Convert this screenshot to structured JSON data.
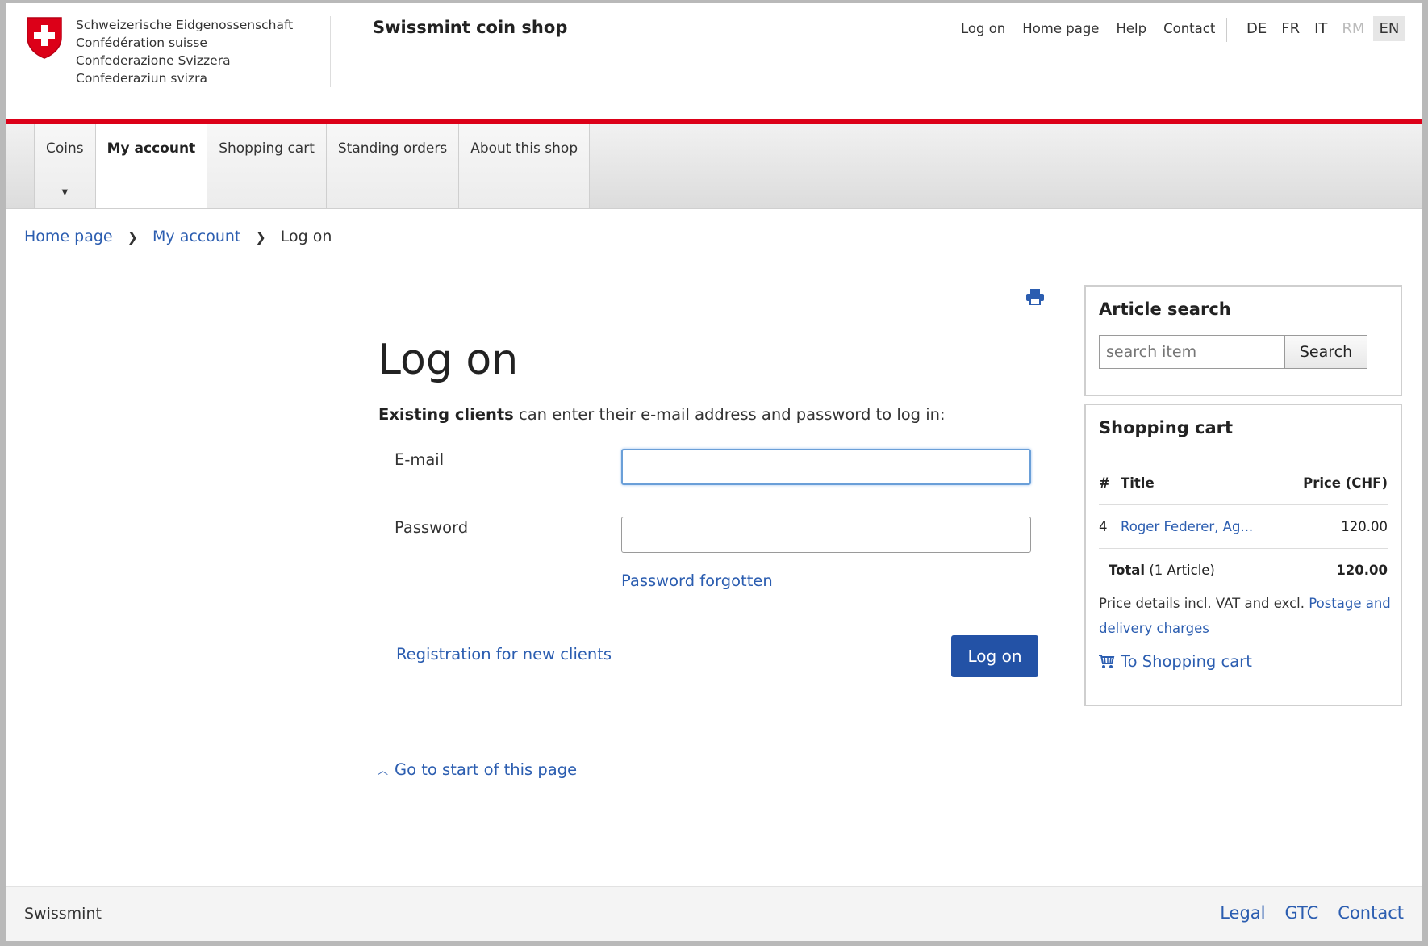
{
  "header": {
    "federation_names": [
      "Schweizerische Eidgenossenschaft",
      "Confédération suisse",
      "Confederazione Svizzera",
      "Confederaziun svizra"
    ],
    "shop_title": "Swissmint coin shop",
    "top_links": [
      "Log on",
      "Home page",
      "Help",
      "Contact"
    ],
    "languages": [
      {
        "code": "DE",
        "state": "normal"
      },
      {
        "code": "FR",
        "state": "normal"
      },
      {
        "code": "IT",
        "state": "normal"
      },
      {
        "code": "RM",
        "state": "disabled"
      },
      {
        "code": "EN",
        "state": "active"
      }
    ]
  },
  "nav": {
    "items": [
      {
        "label": "Coins",
        "has_dropdown": true
      },
      {
        "label": "My account",
        "active": true
      },
      {
        "label": "Shopping cart"
      },
      {
        "label": "Standing orders"
      },
      {
        "label": "About this shop"
      }
    ]
  },
  "breadcrumb": {
    "items": [
      "Home page",
      "My account"
    ],
    "current": "Log on"
  },
  "login": {
    "title": "Log on",
    "intro_bold": "Existing clients",
    "intro_rest": " can enter their e-mail address and password to log in:",
    "email_label": "E-mail",
    "email_value": "",
    "password_label": "Password",
    "password_value": "",
    "password_forgotten": "Password forgotten",
    "registration_link": "Registration for new clients",
    "submit_label": "Log on"
  },
  "sidebar": {
    "search": {
      "title": "Article search",
      "placeholder": "search item",
      "button": "Search"
    },
    "cart": {
      "title": "Shopping cart",
      "col_num": "#",
      "col_title": "Title",
      "col_price": "Price (CHF)",
      "rows": [
        {
          "num": "4",
          "title": "Roger Federer, Ag...",
          "price": "120.00"
        }
      ],
      "total_label": "Total",
      "total_count": " (1 Article)",
      "total_value": "120.00",
      "note_text": "Price details incl. VAT and excl. ",
      "note_link": "Postage and delivery charges",
      "to_cart": "To Shopping cart"
    }
  },
  "to_top": "Go to start of this page",
  "footer": {
    "brand": "Swissmint",
    "links": [
      "Legal",
      "GTC",
      "Contact"
    ]
  },
  "colors": {
    "federal_red": "#dc0018",
    "link_blue": "#2b5db0",
    "button_blue": "#2352a6"
  }
}
